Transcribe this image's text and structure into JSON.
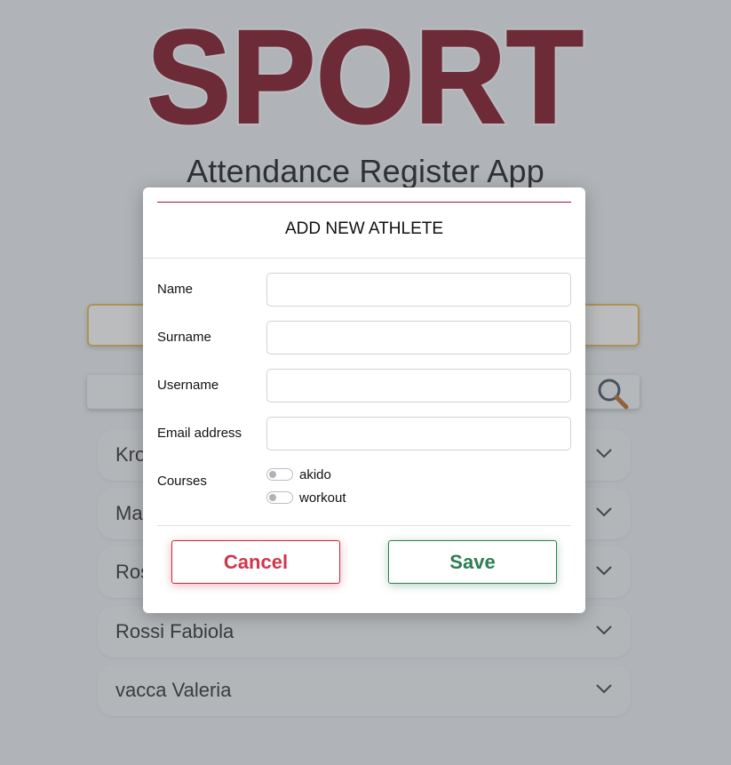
{
  "logo": {
    "text": "SPORT",
    "color": "#7b0619"
  },
  "app_title": "Attendance Register App",
  "search": {
    "icon": "magnifier-icon"
  },
  "athletes": [
    {
      "name": "Kro"
    },
    {
      "name": "Ma"
    },
    {
      "name": "Ros"
    },
    {
      "name": "Rossi Fabiola"
    },
    {
      "name": "vacca Valeria"
    }
  ],
  "modal": {
    "title": "ADD NEW ATHLETE",
    "fields": {
      "name_label": "Name",
      "surname_label": "Surname",
      "username_label": "Username",
      "email_label": "Email address",
      "courses_label": "Courses"
    },
    "values": {
      "name": "",
      "surname": "",
      "username": "",
      "email": ""
    },
    "courses": [
      {
        "label": "akido",
        "enabled": false
      },
      {
        "label": "workout",
        "enabled": false
      }
    ],
    "cancel_label": "Cancel",
    "save_label": "Save"
  },
  "colors": {
    "accent": "#a31230",
    "cancel": "#c42a3b",
    "save": "#2a7f54",
    "input_focus": "#e8b94a"
  }
}
